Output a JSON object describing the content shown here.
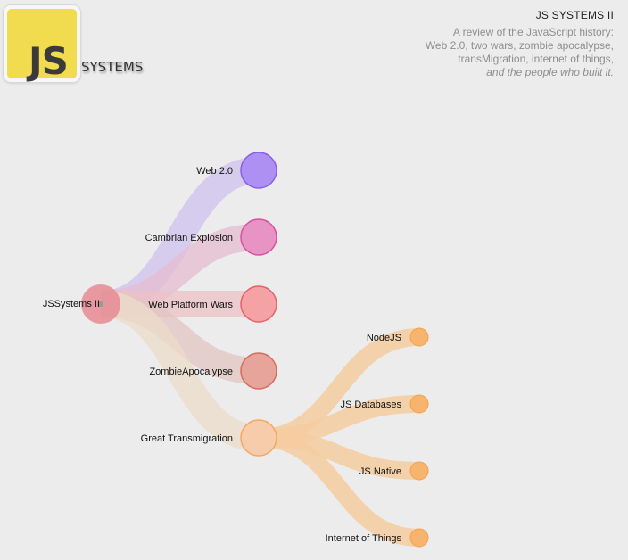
{
  "logo": {
    "js": "JS",
    "systems": "SYSTEMS"
  },
  "header": {
    "title": "JS SYSTEMS II",
    "description_lines": [
      "A review of the JavaScript history:",
      "Web 2.0, two wars, zombie apocalypse,",
      "transMigration, internet of things,"
    ],
    "tagline": "and the people who built it."
  },
  "tree": {
    "root": {
      "label": "JSSystems II",
      "color": "#e68a94"
    },
    "children": [
      {
        "label": "Web 2.0",
        "color": "#ae8ff2",
        "stroke": "#8a5ee8",
        "link": "#cfc2ee"
      },
      {
        "label": "Cambrian Explosion",
        "color": "#e794c4",
        "stroke": "#d9509e",
        "link": "#e6bccf"
      },
      {
        "label": "Web Platform Wars",
        "color": "#f5a2a4",
        "stroke": "#e8606a",
        "link": "#ecc2c5"
      },
      {
        "label": "ZombieApocalypse",
        "color": "#e6a49a",
        "stroke": "#d86a60",
        "link": "#e2c6c2"
      },
      {
        "label": "Great Transmigration",
        "color": "#f7ccaa",
        "stroke": "#f4a860",
        "link": "#ecdccb",
        "children": [
          {
            "label": "NodeJS",
            "color": "#f7b46e",
            "stroke": "#f3a24a",
            "link": "#f5cca0"
          },
          {
            "label": "JS Databases",
            "color": "#f7b46e",
            "stroke": "#f3a24a",
            "link": "#f5cca0"
          },
          {
            "label": "JS Native",
            "color": "#f7b46e",
            "stroke": "#f3a24a",
            "link": "#f5cca0"
          },
          {
            "label": "Internet of Things",
            "color": "#f7b46e",
            "stroke": "#f3a24a",
            "link": "#f5cca0"
          }
        ]
      }
    ]
  }
}
